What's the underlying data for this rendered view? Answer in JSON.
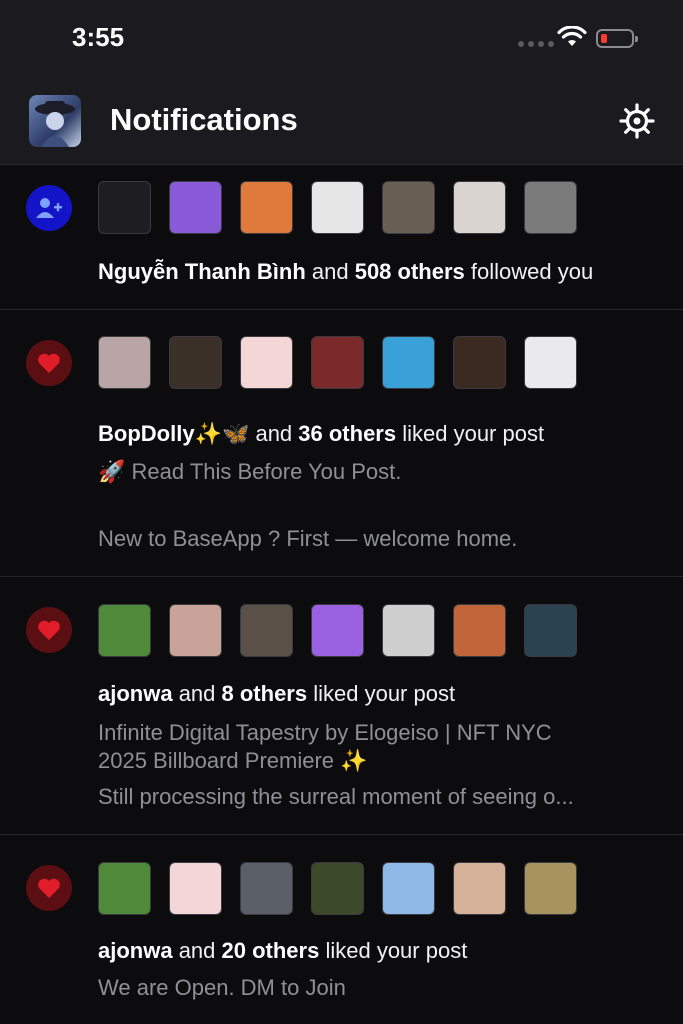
{
  "status_bar": {
    "time": "3:55"
  },
  "header": {
    "title": "Notifications"
  },
  "notifications": [
    {
      "type": "follow",
      "actor": "Nguyễn Thanh Bình",
      "and": " and ",
      "count": "508 others",
      "action": " followed you",
      "avatar_colors": [
        "#1e1e22",
        "#8a5bd8",
        "#e07a3c",
        "#e6e6e6",
        "#6a5f55",
        "#d9d4cf",
        "#7b7b7b"
      ]
    },
    {
      "type": "like",
      "actor": "BopDolly✨🦋",
      "and": " and ",
      "count": "36 others",
      "action": " liked your post",
      "post_line1": "🚀 Read This Before You Post.",
      "post_line2": "New to BaseApp ? First — welcome home.",
      "avatar_colors": [
        "#b9a5a5",
        "#3b3028",
        "#f4d6d6",
        "#7a2a2a",
        "#3aa0d8",
        "#3a2a22",
        "#e9e9ee"
      ]
    },
    {
      "type": "like",
      "actor": "ajonwa",
      "and": " and ",
      "count": "8 others",
      "action": " liked your post",
      "post_line1": "Infinite Digital Tapestry by Elogeiso | NFT NYC",
      "post_line2": "2025 Billboard Premiere ✨",
      "post_line3": "Still processing the surreal moment of seeing o...",
      "avatar_colors": [
        "#4f8a3a",
        "#c9a39a",
        "#5a5048",
        "#9a62e0",
        "#cfcfcf",
        "#c0663a",
        "#2b4250"
      ]
    },
    {
      "type": "like",
      "actor": "ajonwa",
      "and": " and ",
      "count": "20 others",
      "action": " liked your post",
      "post_line1": "We are Open. DM to Join",
      "avatar_colors": [
        "#4f8a3a",
        "#f4d6d6",
        "#5b5f66",
        "#3d4a2a",
        "#8fb8e6",
        "#d6b29a",
        "#a8925e"
      ]
    }
  ]
}
